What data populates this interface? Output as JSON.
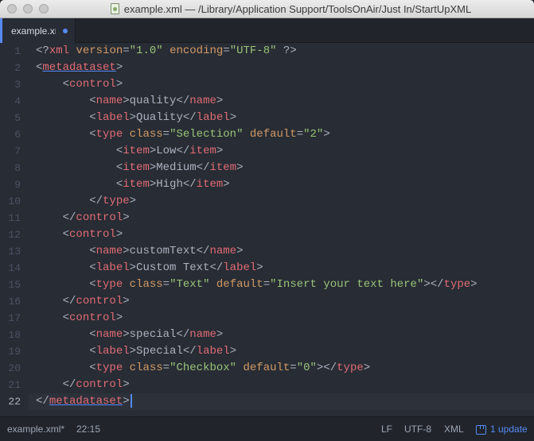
{
  "window": {
    "title": "example.xml — /Library/Application Support/ToolsOnAir/Just In/StartUpXML"
  },
  "tabs": [
    {
      "label": "example.xml",
      "modified": true
    }
  ],
  "editor": {
    "line_numbers": [
      "1",
      "2",
      "3",
      "4",
      "5",
      "6",
      "7",
      "8",
      "9",
      "10",
      "11",
      "12",
      "13",
      "14",
      "15",
      "16",
      "17",
      "18",
      "19",
      "20",
      "21",
      "22"
    ],
    "active_line": "22",
    "lines": [
      [
        [
          "punct",
          "<?"
        ],
        [
          "tag",
          "xml"
        ],
        [
          "txt",
          " "
        ],
        [
          "attr",
          "version"
        ],
        [
          "punct",
          "="
        ],
        [
          "str",
          "\"1.0\""
        ],
        [
          "txt",
          " "
        ],
        [
          "attr",
          "encoding"
        ],
        [
          "punct",
          "="
        ],
        [
          "str",
          "\"UTF-8\""
        ],
        [
          "txt",
          " "
        ],
        [
          "punct",
          "?>"
        ]
      ],
      [
        [
          "punct",
          "<"
        ],
        [
          "tag u",
          "metadataset"
        ],
        [
          "punct",
          ">"
        ]
      ],
      [
        [
          "txt",
          "    "
        ],
        [
          "punct",
          "<"
        ],
        [
          "tag",
          "control"
        ],
        [
          "punct",
          ">"
        ]
      ],
      [
        [
          "txt",
          "        "
        ],
        [
          "punct",
          "<"
        ],
        [
          "tag",
          "name"
        ],
        [
          "punct",
          ">"
        ],
        [
          "txt",
          "quality"
        ],
        [
          "punct",
          "</"
        ],
        [
          "tag",
          "name"
        ],
        [
          "punct",
          ">"
        ]
      ],
      [
        [
          "txt",
          "        "
        ],
        [
          "punct",
          "<"
        ],
        [
          "tag",
          "label"
        ],
        [
          "punct",
          ">"
        ],
        [
          "txt",
          "Quality"
        ],
        [
          "punct",
          "</"
        ],
        [
          "tag",
          "label"
        ],
        [
          "punct",
          ">"
        ]
      ],
      [
        [
          "txt",
          "        "
        ],
        [
          "punct",
          "<"
        ],
        [
          "tag",
          "type"
        ],
        [
          "txt",
          " "
        ],
        [
          "attr",
          "class"
        ],
        [
          "punct",
          "="
        ],
        [
          "str",
          "\"Selection\""
        ],
        [
          "txt",
          " "
        ],
        [
          "attr",
          "default"
        ],
        [
          "punct",
          "="
        ],
        [
          "str",
          "\"2\""
        ],
        [
          "punct",
          ">"
        ]
      ],
      [
        [
          "txt",
          "            "
        ],
        [
          "punct",
          "<"
        ],
        [
          "tag",
          "item"
        ],
        [
          "punct",
          ">"
        ],
        [
          "txt",
          "Low"
        ],
        [
          "punct",
          "</"
        ],
        [
          "tag",
          "item"
        ],
        [
          "punct",
          ">"
        ]
      ],
      [
        [
          "txt",
          "            "
        ],
        [
          "punct",
          "<"
        ],
        [
          "tag",
          "item"
        ],
        [
          "punct",
          ">"
        ],
        [
          "txt",
          "Medium"
        ],
        [
          "punct",
          "</"
        ],
        [
          "tag",
          "item"
        ],
        [
          "punct",
          ">"
        ]
      ],
      [
        [
          "txt",
          "            "
        ],
        [
          "punct",
          "<"
        ],
        [
          "tag",
          "item"
        ],
        [
          "punct",
          ">"
        ],
        [
          "txt",
          "High"
        ],
        [
          "punct",
          "</"
        ],
        [
          "tag",
          "item"
        ],
        [
          "punct",
          ">"
        ]
      ],
      [
        [
          "txt",
          "        "
        ],
        [
          "punct",
          "</"
        ],
        [
          "tag",
          "type"
        ],
        [
          "punct",
          ">"
        ]
      ],
      [
        [
          "txt",
          "    "
        ],
        [
          "punct",
          "</"
        ],
        [
          "tag",
          "control"
        ],
        [
          "punct",
          ">"
        ]
      ],
      [
        [
          "txt",
          "    "
        ],
        [
          "punct",
          "<"
        ],
        [
          "tag",
          "control"
        ],
        [
          "punct",
          ">"
        ]
      ],
      [
        [
          "txt",
          "        "
        ],
        [
          "punct",
          "<"
        ],
        [
          "tag",
          "name"
        ],
        [
          "punct",
          ">"
        ],
        [
          "txt",
          "customText"
        ],
        [
          "punct",
          "</"
        ],
        [
          "tag",
          "name"
        ],
        [
          "punct",
          ">"
        ]
      ],
      [
        [
          "txt",
          "        "
        ],
        [
          "punct",
          "<"
        ],
        [
          "tag",
          "label"
        ],
        [
          "punct",
          ">"
        ],
        [
          "txt",
          "Custom Text"
        ],
        [
          "punct",
          "</"
        ],
        [
          "tag",
          "label"
        ],
        [
          "punct",
          ">"
        ]
      ],
      [
        [
          "txt",
          "        "
        ],
        [
          "punct",
          "<"
        ],
        [
          "tag",
          "type"
        ],
        [
          "txt",
          " "
        ],
        [
          "attr",
          "class"
        ],
        [
          "punct",
          "="
        ],
        [
          "str",
          "\"Text\""
        ],
        [
          "txt",
          " "
        ],
        [
          "attr",
          "default"
        ],
        [
          "punct",
          "="
        ],
        [
          "str",
          "\"Insert your text here\""
        ],
        [
          "punct",
          "></"
        ],
        [
          "tag",
          "type"
        ],
        [
          "punct",
          ">"
        ]
      ],
      [
        [
          "txt",
          "    "
        ],
        [
          "punct",
          "</"
        ],
        [
          "tag",
          "control"
        ],
        [
          "punct",
          ">"
        ]
      ],
      [
        [
          "txt",
          "    "
        ],
        [
          "punct",
          "<"
        ],
        [
          "tag",
          "control"
        ],
        [
          "punct",
          ">"
        ]
      ],
      [
        [
          "txt",
          "        "
        ],
        [
          "punct",
          "<"
        ],
        [
          "tag",
          "name"
        ],
        [
          "punct",
          ">"
        ],
        [
          "txt",
          "special"
        ],
        [
          "punct",
          "</"
        ],
        [
          "tag",
          "name"
        ],
        [
          "punct",
          ">"
        ]
      ],
      [
        [
          "txt",
          "        "
        ],
        [
          "punct",
          "<"
        ],
        [
          "tag",
          "label"
        ],
        [
          "punct",
          ">"
        ],
        [
          "txt",
          "Special"
        ],
        [
          "punct",
          "</"
        ],
        [
          "tag",
          "label"
        ],
        [
          "punct",
          ">"
        ]
      ],
      [
        [
          "txt",
          "        "
        ],
        [
          "punct",
          "<"
        ],
        [
          "tag",
          "type"
        ],
        [
          "txt",
          " "
        ],
        [
          "attr",
          "class"
        ],
        [
          "punct",
          "="
        ],
        [
          "str",
          "\"Checkbox\""
        ],
        [
          "txt",
          " "
        ],
        [
          "attr",
          "default"
        ],
        [
          "punct",
          "="
        ],
        [
          "str",
          "\"0\""
        ],
        [
          "punct",
          "></"
        ],
        [
          "tag",
          "type"
        ],
        [
          "punct",
          ">"
        ]
      ],
      [
        [
          "txt",
          "    "
        ],
        [
          "punct",
          "</"
        ],
        [
          "tag",
          "control"
        ],
        [
          "punct",
          ">"
        ]
      ],
      [
        [
          "punct",
          "</"
        ],
        [
          "tag u",
          "metadataset"
        ],
        [
          "punct",
          ">"
        ]
      ]
    ]
  },
  "statusbar": {
    "file": "example.xml*",
    "cursor_position": "22:15",
    "line_ending": "LF",
    "encoding": "UTF-8",
    "grammar": "XML",
    "updates": "1 update"
  },
  "colors": {
    "tag": "#e06c75",
    "attribute": "#d19a66",
    "string": "#98c379",
    "text": "#abb2bf",
    "accent": "#568af2",
    "background": "#282c34"
  }
}
